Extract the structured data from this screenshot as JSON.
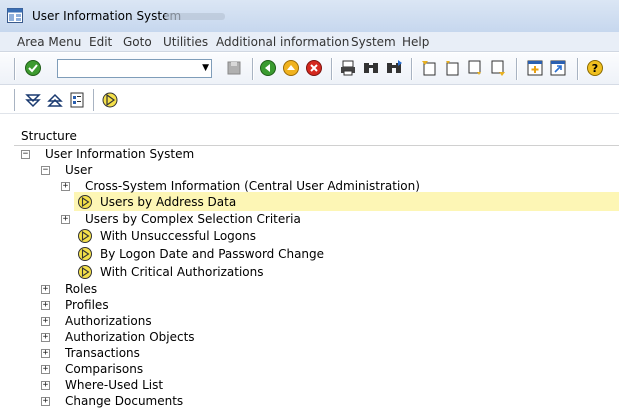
{
  "window": {
    "title": "User Information System"
  },
  "menu": {
    "items": [
      "Area Menu",
      "Edit",
      "Goto",
      "Utilities",
      "Additional information",
      "System",
      "Help"
    ]
  },
  "toolbar": {
    "command_value": ""
  },
  "structure": {
    "label": "Structure",
    "root": "User Information System",
    "user": "User",
    "user_children": [
      {
        "label": "Cross-System Information (Central User Administration)",
        "kind": "folder"
      },
      {
        "label": "Users by Address Data",
        "kind": "report",
        "selected": true
      },
      {
        "label": "Users by Complex Selection Criteria",
        "kind": "folder"
      },
      {
        "label": "With Unsuccessful Logons",
        "kind": "report"
      },
      {
        "label": "By Logon Date and Password Change",
        "kind": "report"
      },
      {
        "label": "With Critical Authorizations",
        "kind": "report"
      }
    ],
    "top_level": [
      "Roles",
      "Profiles",
      "Authorizations",
      "Authorization Objects",
      "Transactions",
      "Comparisons",
      "Where-Used List",
      "Change Documents"
    ]
  },
  "colors": {
    "selection": "#fdf6b5",
    "titlebar": "#c6d7ee"
  }
}
